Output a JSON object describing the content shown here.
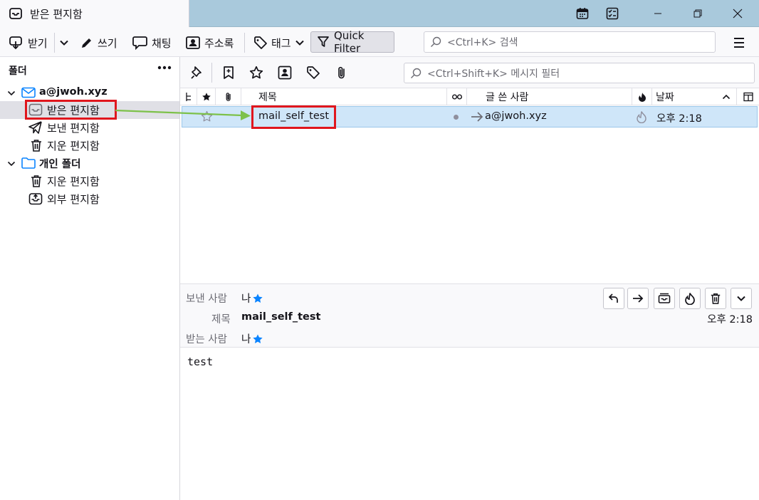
{
  "tab": {
    "title": "받은 편지함"
  },
  "toolbar": {
    "get_messages": "받기",
    "write": "쓰기",
    "chat": "채팅",
    "address_book": "주소록",
    "tag": "태그",
    "quick_filter": "Quick Filter",
    "search_placeholder": "<Ctrl+K> 검색"
  },
  "folder_pane": {
    "header": "폴더",
    "account": "a@jwoh.xyz",
    "account_folders": [
      {
        "label": "받은 편지함",
        "icon": "inbox-icon"
      },
      {
        "label": "보낸 편지함",
        "icon": "send-icon"
      },
      {
        "label": "지운 편지함",
        "icon": "trash-icon"
      }
    ],
    "local": "개인 폴더",
    "local_folders": [
      {
        "label": "지운 편지함",
        "icon": "trash-icon"
      },
      {
        "label": "외부 편지함",
        "icon": "outbox-icon"
      }
    ]
  },
  "message_list": {
    "filter_placeholder": "<Ctrl+Shift+K> 메시지 필터",
    "columns": {
      "subject": "제목",
      "correspondent": "글 쓴 사람",
      "date": "날짜"
    },
    "rows": [
      {
        "subject": "mail_self_test",
        "correspondent": "a@jwoh.xyz",
        "date": "오후 2:18"
      }
    ]
  },
  "message_header": {
    "from_label": "보낸 사람",
    "from_value": "나",
    "subject_label": "제목",
    "subject_value": "mail_self_test",
    "to_label": "받는 사람",
    "to_value": "나",
    "date": "오후 2:18"
  },
  "message_body": "test",
  "colors": {
    "titlebar": "#a9c9dc",
    "selection": "#cfe6f9",
    "annotation_red": "#e0161d",
    "annotation_green": "#7dc14a",
    "star_blue": "#0a84ff"
  }
}
